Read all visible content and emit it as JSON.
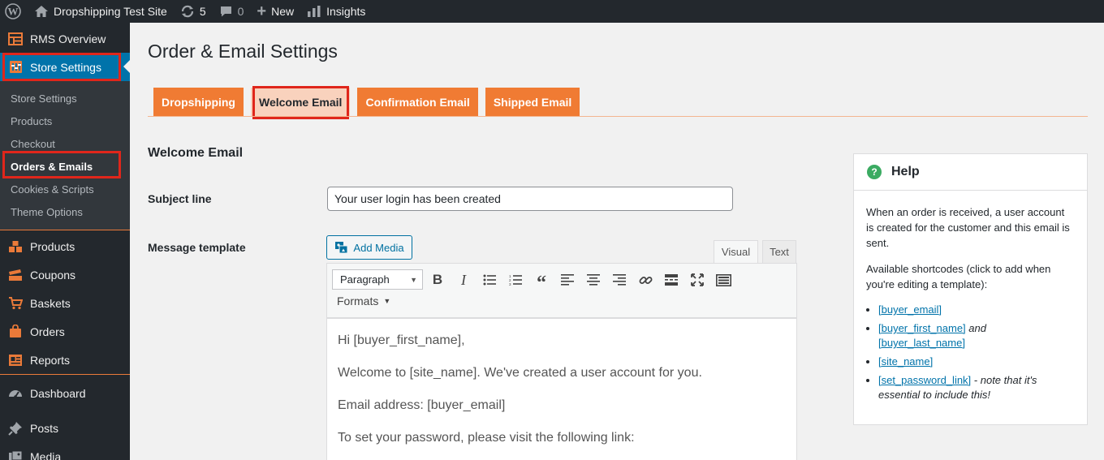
{
  "adminbar": {
    "site_name": "Dropshipping Test Site",
    "updates_count": "5",
    "comments_count": "0",
    "new_label": "New",
    "insights_label": "Insights"
  },
  "sidebar": {
    "rms_overview": "RMS Overview",
    "store_settings": "Store Settings",
    "submenu": [
      "Store Settings",
      "Products",
      "Checkout",
      "Orders & Emails",
      "Cookies & Scripts",
      "Theme Options"
    ],
    "products": "Products",
    "coupons": "Coupons",
    "baskets": "Baskets",
    "orders": "Orders",
    "reports": "Reports",
    "dashboard": "Dashboard",
    "posts": "Posts",
    "media": "Media"
  },
  "page": {
    "title": "Order & Email Settings",
    "tabs": [
      "Dropshipping",
      "Welcome Email",
      "Confirmation Email",
      "Shipped Email"
    ],
    "section_title": "Welcome Email",
    "subject_label": "Subject line",
    "subject_value": "Your user login has been created",
    "message_label": "Message template"
  },
  "editor": {
    "add_media": "Add Media",
    "tab_visual": "Visual",
    "tab_text": "Text",
    "format_value": "Paragraph",
    "formats_label": "Formats",
    "content": [
      "Hi [buyer_first_name],",
      "Welcome to [site_name]. We've created a user account for you.",
      "Email address: [buyer_email]",
      "To set your password, please visit the following link:"
    ]
  },
  "help": {
    "title": "Help",
    "para1": "When an order is received, a user account is created for the customer and this email is sent.",
    "para2": "Available shortcodes (click to add when you're editing a template):",
    "codes": {
      "buyer_email": "[buyer_email]",
      "buyer_first_name": "[buyer_first_name]",
      "and_word": "and",
      "buyer_last_name": "[buyer_last_name]",
      "site_name": "[site_name]",
      "set_password_link": "[set_password_link]",
      "note": "- note that it's essential to include this!"
    }
  },
  "colors": {
    "adminbar_bg": "#23282d",
    "current_menu_bg": "#0073aa",
    "tab_orange": "#f07b33",
    "tab_active": "#f9d2bd",
    "highlight_red": "#e0261b",
    "help_green": "#3bab62"
  }
}
